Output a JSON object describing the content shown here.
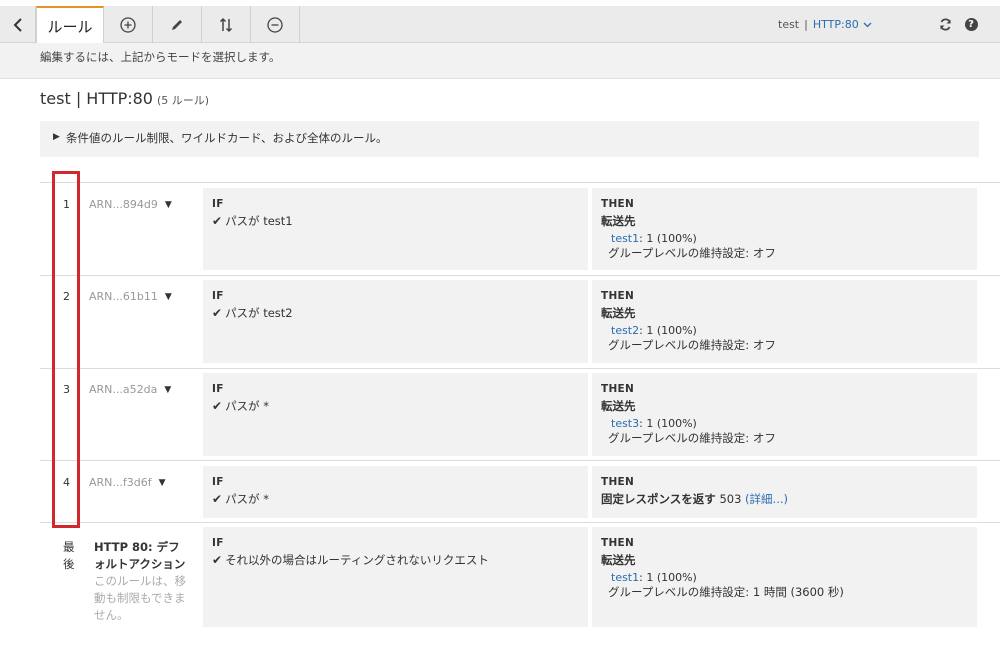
{
  "toolbar": {
    "back_icon": "chevron-left-icon",
    "tab_label": "ルール",
    "listener_name": "test",
    "listener_separator": "|",
    "listener_protocol": "HTTP:80"
  },
  "hint": "編集するには、上記からモードを選択します。",
  "page": {
    "title": "test | HTTP:80",
    "rule_count": "(5 ルール)"
  },
  "info_bar": "条件値のルール制限、ワイルドカード、および全体のルール。",
  "rules": [
    {
      "number": "1",
      "arn": "ARN...894d9",
      "if_label": "IF",
      "condition": "パスが test1",
      "then_label": "THEN",
      "action_title": "転送先",
      "target": "test1",
      "target_detail": ": 1 (100%)",
      "stickiness": "グループレベルの維持設定: オフ"
    },
    {
      "number": "2",
      "arn": "ARN...61b11",
      "if_label": "IF",
      "condition": "パスが test2",
      "then_label": "THEN",
      "action_title": "転送先",
      "target": "test2",
      "target_detail": ": 1 (100%)",
      "stickiness": "グループレベルの維持設定: オフ"
    },
    {
      "number": "3",
      "arn": "ARN...a52da",
      "if_label": "IF",
      "condition": "パスが *",
      "then_label": "THEN",
      "action_title": "転送先",
      "target": "test3",
      "target_detail": ": 1 (100%)",
      "stickiness": "グループレベルの維持設定: オフ"
    },
    {
      "number": "4",
      "arn": "ARN...f3d6f",
      "if_label": "IF",
      "condition": "パスが *",
      "then_label": "THEN",
      "action_title": "固定レスポンスを返す",
      "response_code": "503",
      "details_link": "(詳細...)"
    }
  ],
  "default_rule": {
    "label": "最後",
    "name": "HTTP 80: デフォルトアクション",
    "note": "このルールは、移動も制限もできません。",
    "if_label": "IF",
    "condition": "それ以外の場合はルーティングされないリクエスト",
    "then_label": "THEN",
    "action_title": "転送先",
    "target": "test1",
    "target_detail": ": 1 (100%)",
    "stickiness_label": "グループレベルの維持設定:",
    "stickiness_value": "1 時間 (3600 秒)"
  },
  "colors": {
    "accent_tab": "#e8912d",
    "link": "#2b6cb0",
    "highlight": "#d0282e"
  }
}
